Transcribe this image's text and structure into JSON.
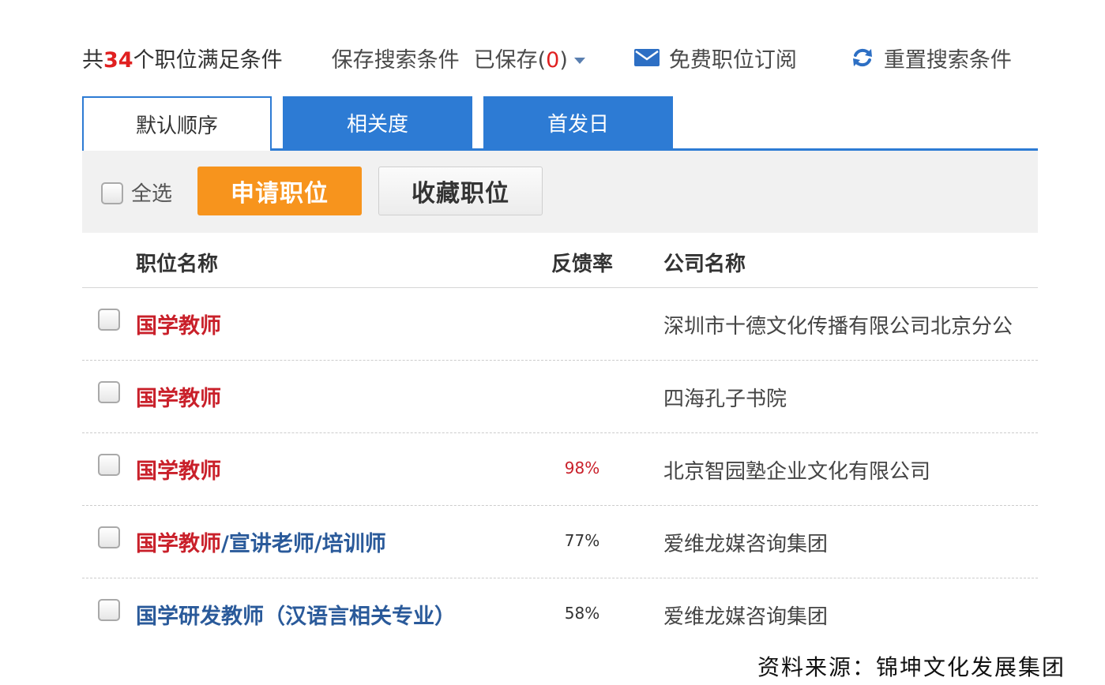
{
  "topbar": {
    "count_prefix": "共",
    "count_number": "34",
    "count_suffix": "个职位满足条件",
    "save_search": "保存搜索条件",
    "saved_prefix": "已保存(",
    "saved_count": "0",
    "saved_suffix": ")",
    "subscribe": "免费职位订阅",
    "reset": "重置搜索条件"
  },
  "tabs": [
    {
      "label": "默认顺序",
      "active": true
    },
    {
      "label": "相关度",
      "active": false
    },
    {
      "label": "首发日",
      "active": false
    }
  ],
  "actions": {
    "select_all": "全选",
    "apply": "申请职位",
    "favorite": "收藏职位"
  },
  "table": {
    "headers": {
      "name": "职位名称",
      "rate": "反馈率",
      "company": "公司名称"
    },
    "rows": [
      {
        "title_red": "国学教师",
        "title_blue": "",
        "rate": "",
        "company": "深圳市十德文化传播有限公司北京分公"
      },
      {
        "title_red": "国学教师",
        "title_blue": "",
        "rate": "",
        "company": "四海孔子书院"
      },
      {
        "title_red": "国学教师",
        "title_blue": "",
        "rate": "98%",
        "company": "北京智园塾企业文化有限公司"
      },
      {
        "title_red": "国学教师",
        "title_blue": "/宣讲老师/培训师",
        "rate": "77%",
        "company": "爱维龙媒咨询集团"
      },
      {
        "title_red": "",
        "title_blue": "国学研发教师（汉语言相关专业）",
        "rate": "58%",
        "company": "爱维龙媒咨询集团"
      }
    ]
  },
  "source": "资料来源：锦坤文化发展集团",
  "colors": {
    "accent_blue": "#2d7bd4",
    "apply_orange": "#f7941d",
    "highlight_red": "#c9202a"
  },
  "icons": {
    "mail": "mail-icon",
    "refresh": "refresh-icon",
    "caret": "chevron-down-icon"
  }
}
